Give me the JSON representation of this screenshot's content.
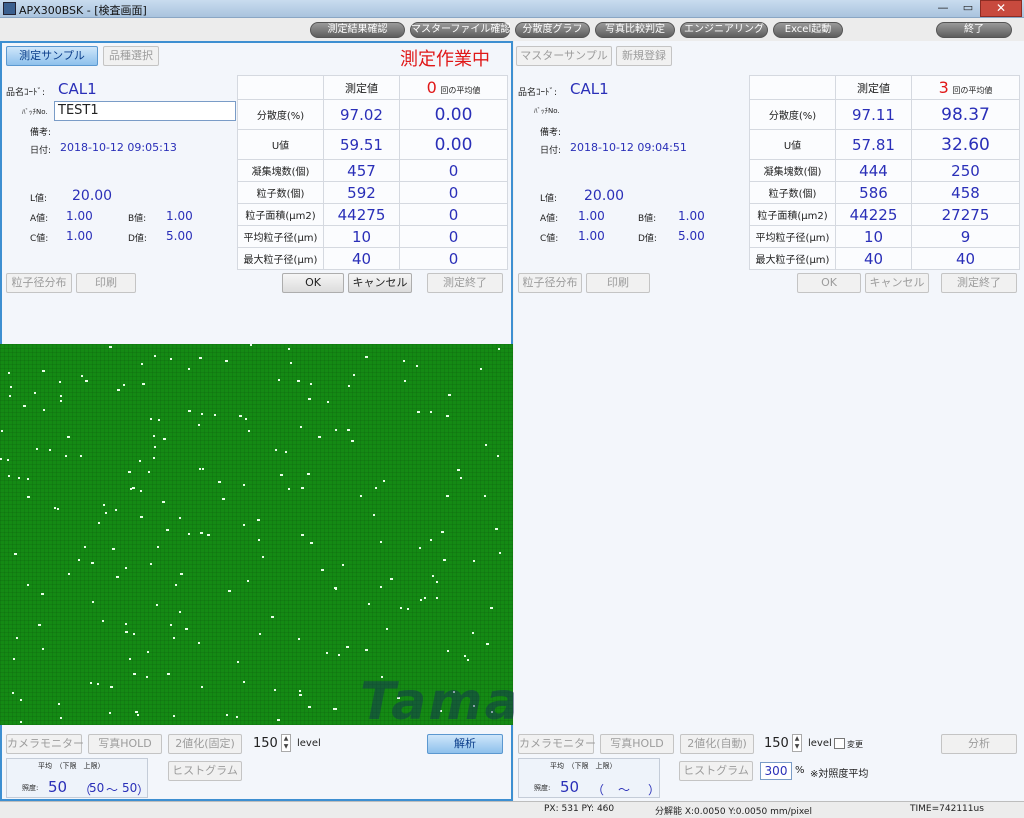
{
  "window": {
    "title": "APX300BSK - [検査画面]",
    "close": "✕"
  },
  "toolbar": [
    "測定結果確認",
    "マスターファイル確認",
    "分散度グラフ",
    "写真比較判定",
    "エンジニアリング",
    "Excel起動",
    "終了"
  ],
  "left": {
    "tab_active": "測定サンプル",
    "tab_other": "品種選択",
    "status": "測定作業中",
    "hinmei_label": "品名ｺｰﾄﾞ:",
    "hinmei_value": "CAL1",
    "batch_label": "ﾊﾞｯﾁNo.",
    "batch_value": "TEST1",
    "bikou_label": "備考:",
    "date_label": "日付:",
    "date_value": "2018-10-12 09:05:13",
    "L_label": "L値:",
    "L_value": "20.00",
    "A_label": "A値:",
    "A_value": "1.00",
    "B_label": "B値:",
    "B_value": "1.00",
    "C_label": "C値:",
    "C_value": "1.00",
    "D_label": "D値:",
    "D_value": "5.00",
    "col_measure": "測定値",
    "count": "0",
    "count_label": "回の平均値",
    "rows": [
      {
        "label": "分散度(%)",
        "measured": "97.02",
        "avg": "0.00"
      },
      {
        "label": "U値",
        "measured": "59.51",
        "avg": "0.00"
      },
      {
        "label": "凝集塊数(個)",
        "measured": "457",
        "avg": "0"
      },
      {
        "label": "粒子数(個)",
        "measured": "592",
        "avg": "0"
      },
      {
        "label": "粒子面積(μm2)",
        "measured": "44275",
        "avg": "0"
      },
      {
        "label": "平均粒子径(μm)",
        "measured": "10",
        "avg": "0"
      },
      {
        "label": "最大粒子径(μm)",
        "measured": "40",
        "avg": "0"
      }
    ],
    "btn_dist": "粒子径分布",
    "btn_print": "印刷",
    "btn_ok": "OK",
    "btn_cancel": "キャンセル",
    "btn_end": "測定終了",
    "btn_camera": "カメラモニター",
    "btn_hold": "写真HOLD",
    "btn_binar": "2値化(固定)",
    "level_value": "150",
    "level_label": "level",
    "btn_analyze": "解析",
    "btn_hist": "ヒストグラム",
    "avg_header": "平均　（下限　上限）",
    "illum_label": "照度:",
    "illum_value": "50",
    "illum_open": "（",
    "illum_low": "50",
    "illum_sep": "～",
    "illum_high": "50",
    "illum_close": "）"
  },
  "right": {
    "tab_master": "マスターサンプル",
    "tab_new": "新規登録",
    "hinmei_label": "品名ｺｰﾄﾞ:",
    "hinmei_value": "CAL1",
    "batch_label": "ﾊﾞｯﾁNo.",
    "bikou_label": "備考:",
    "date_label": "日付:",
    "date_value": "2018-10-12 09:04:51",
    "L_label": "L値:",
    "L_value": "20.00",
    "A_label": "A値:",
    "A_value": "1.00",
    "B_label": "B値:",
    "B_value": "1.00",
    "C_label": "C値:",
    "C_value": "1.00",
    "D_label": "D値:",
    "D_value": "5.00",
    "col_measure": "測定値",
    "count": "3",
    "count_label": "回の平均値",
    "rows": [
      {
        "label": "分散度(%)",
        "measured": "97.11",
        "avg": "98.37"
      },
      {
        "label": "U値",
        "measured": "57.81",
        "avg": "32.60"
      },
      {
        "label": "凝集塊数(個)",
        "measured": "444",
        "avg": "250"
      },
      {
        "label": "粒子数(個)",
        "measured": "586",
        "avg": "458"
      },
      {
        "label": "粒子面積(μm2)",
        "measured": "44225",
        "avg": "27275"
      },
      {
        "label": "平均粒子径(μm)",
        "measured": "10",
        "avg": "9"
      },
      {
        "label": "最大粒子径(μm)",
        "measured": "40",
        "avg": "40"
      }
    ],
    "btn_dist": "粒子径分布",
    "btn_print": "印刷",
    "btn_ok": "OK",
    "btn_cancel": "キャンセル",
    "btn_end": "測定終了",
    "btn_camera": "カメラモニター",
    "btn_hold": "写真HOLD",
    "btn_binar": "2値化(自動)",
    "level_value": "150",
    "level_label": "level",
    "change_label": "変更",
    "btn_analyze": "分析",
    "btn_hist": "ヒストグラム",
    "percent_value": "300",
    "percent_unit": "%",
    "percent_note": "※対照度平均",
    "avg_header": "平均　（下限　上限）",
    "illum_label": "照度:",
    "illum_value": "50",
    "illum_open": "（",
    "illum_sep": "～",
    "illum_close": "）"
  },
  "watermark": "Tamasaki",
  "status": {
    "px": "PX: 531  PY: 460",
    "res": "分解能 X:0.0050  Y:0.0050 mm/pixel",
    "time": "TIME=742111us"
  }
}
